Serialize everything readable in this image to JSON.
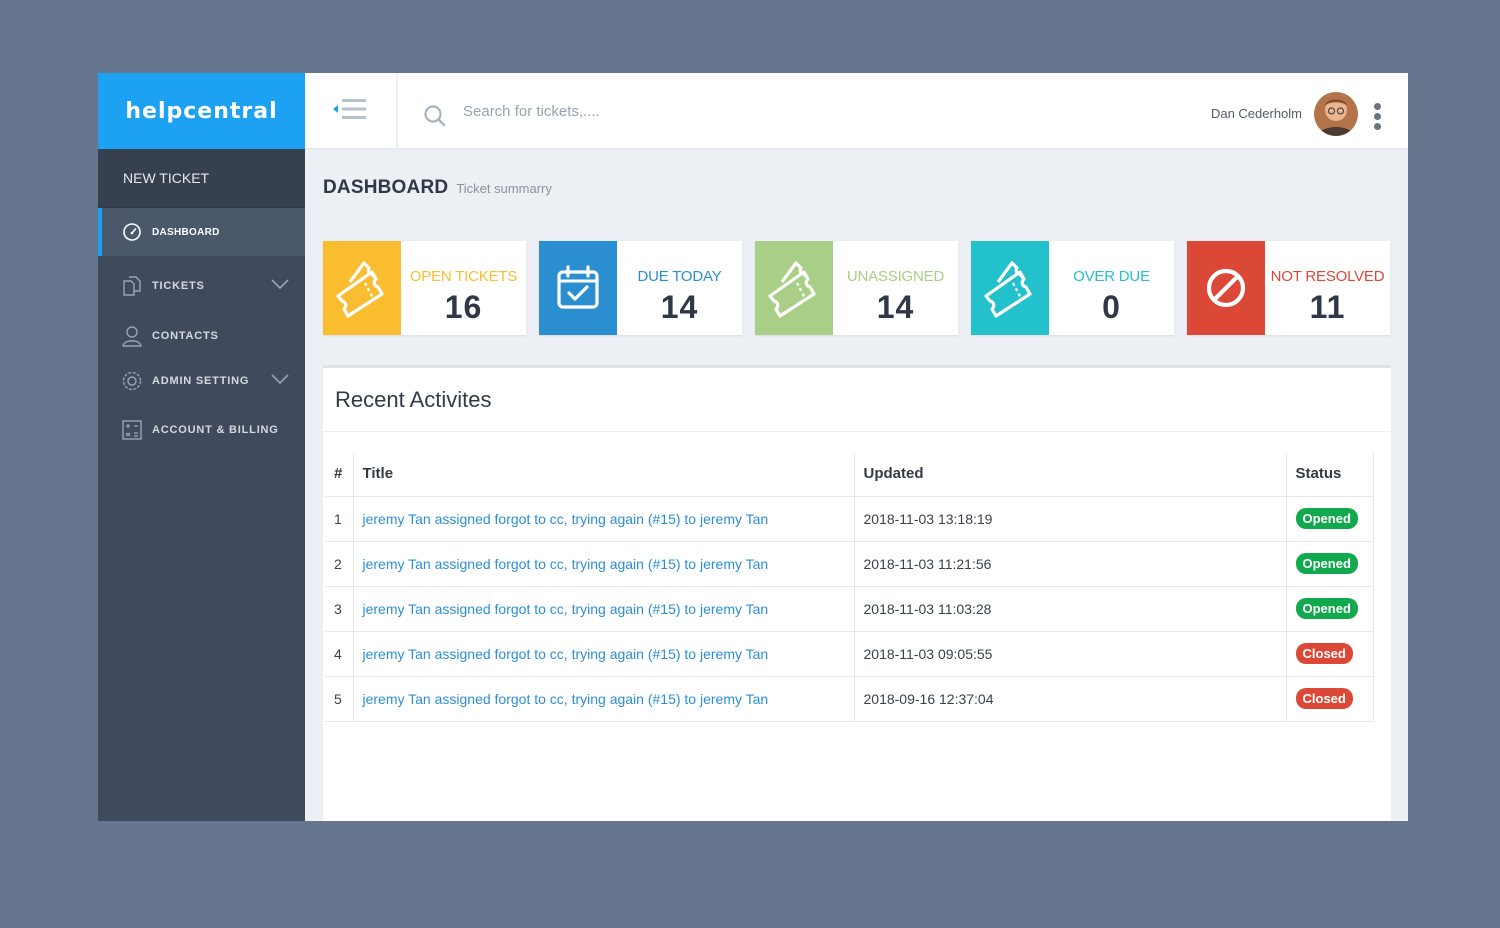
{
  "brand": "helpcentral",
  "sidebar": {
    "new_ticket": "NEW TICKET",
    "items": [
      {
        "label": "DASHBOARD",
        "icon": "speedometer-icon"
      },
      {
        "label": "TICKETS",
        "icon": "documents-icon"
      },
      {
        "label": "CONTACTS",
        "icon": "user-icon"
      },
      {
        "label": "ADMIN SETTING",
        "icon": "gear-icon"
      },
      {
        "label": "ACCOUNT & BILLING",
        "icon": "calculator-icon"
      }
    ]
  },
  "search": {
    "placeholder": "Search for tickets,...."
  },
  "user": {
    "name": "Dan Cederholm"
  },
  "page": {
    "title": "DASHBOARD",
    "subtitle": "Ticket summarry"
  },
  "stats": [
    {
      "label": "OPEN TICKETS",
      "value": "16",
      "color": "#fbbd30",
      "icon": "ticket-icon"
    },
    {
      "label": "DUE TODAY",
      "value": "14",
      "color": "#2b8fcf",
      "icon": "calendar-check-icon"
    },
    {
      "label": "UNASSIGNED",
      "value": "14",
      "color": "#a8cf85",
      "icon": "ticket-icon"
    },
    {
      "label": "OVER DUE",
      "value": "0",
      "color": "#23c1cb",
      "icon": "ticket-icon"
    },
    {
      "label": "NOT RESOLVED",
      "value": "11",
      "color": "#dc4838",
      "icon": "prohibited-icon"
    }
  ],
  "activities": {
    "title": "Recent Activites",
    "columns": [
      "#",
      "Title",
      "Updated",
      "Status"
    ],
    "rows": [
      {
        "num": "1",
        "title": "jeremy Tan assigned forgot to cc, trying again (#15) to jeremy Tan",
        "updated": "2018-11-03 13:18:19",
        "status": "Opened"
      },
      {
        "num": "2",
        "title": "jeremy Tan assigned forgot to cc, trying again (#15) to jeremy Tan",
        "updated": "2018-11-03 11:21:56",
        "status": "Opened"
      },
      {
        "num": "3",
        "title": "jeremy Tan assigned forgot to cc, trying again (#15) to jeremy Tan",
        "updated": "2018-11-03 11:03:28",
        "status": "Opened"
      },
      {
        "num": "4",
        "title": "jeremy Tan assigned forgot to cc, trying again (#15) to jeremy Tan",
        "updated": "2018-11-03 09:05:55",
        "status": "Closed"
      },
      {
        "num": "5",
        "title": "jeremy Tan assigned forgot to cc, trying again (#15) to jeremy Tan",
        "updated": "2018-09-16 12:37:04",
        "status": "Closed"
      }
    ],
    "status_colors": {
      "Opened": "#12a94e",
      "Closed": "#dc4838"
    }
  },
  "colors": {
    "accent": "#1da1f2",
    "sidebar": "#3f4a5d",
    "link": "#2b8fd6"
  }
}
